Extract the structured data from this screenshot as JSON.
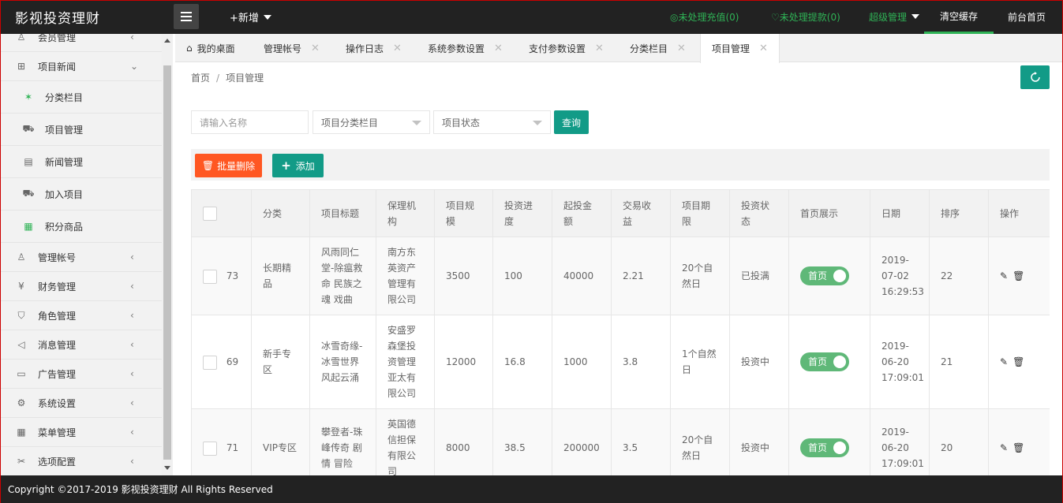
{
  "header": {
    "logo": "影视投资理财",
    "new_label": "+新增",
    "pending_recharge": "未处理充值(0)",
    "pending_withdraw": "未处理提款(0)",
    "admin_label": "超级管理",
    "clear_cache": "清空缓存",
    "front_home": "前台首页"
  },
  "sidebar": {
    "items": [
      {
        "label": "会员管理",
        "icon": "user-icon"
      },
      {
        "label": "项目新闻",
        "icon": "book-icon"
      },
      {
        "label": "分类栏目",
        "icon": "palm-icon"
      },
      {
        "label": "项目管理",
        "icon": "cart-icon"
      },
      {
        "label": "新闻管理",
        "icon": "doc-icon"
      },
      {
        "label": "加入项目",
        "icon": "cart-add-icon"
      },
      {
        "label": "积分商品",
        "icon": "grid-icon"
      },
      {
        "label": "管理帐号",
        "icon": "user-icon"
      },
      {
        "label": "财务管理",
        "icon": "yen-icon"
      },
      {
        "label": "角色管理",
        "icon": "shield-icon"
      },
      {
        "label": "消息管理",
        "icon": "speaker-icon"
      },
      {
        "label": "广告管理",
        "icon": "image-icon"
      },
      {
        "label": "系统设置",
        "icon": "gear-icon"
      },
      {
        "label": "菜单管理",
        "icon": "apps-icon"
      },
      {
        "label": "选项配置",
        "icon": "tools-icon"
      }
    ]
  },
  "tabs": [
    {
      "label": "我的桌面"
    },
    {
      "label": "管理帐号"
    },
    {
      "label": "操作日志"
    },
    {
      "label": "系统参数设置"
    },
    {
      "label": "支付参数设置"
    },
    {
      "label": "分类栏目"
    },
    {
      "label": "项目管理"
    }
  ],
  "breadcrumb": {
    "home": "首页",
    "sep": "/",
    "current": "项目管理"
  },
  "filters": {
    "name_placeholder": "请输入名称",
    "category_select": "项目分类栏目",
    "status_select": "项目状态",
    "query": "查询"
  },
  "toolbar": {
    "batch_delete": "批量删除",
    "add": "添加"
  },
  "table": {
    "headers": [
      "分类",
      "项目标题",
      "保理机构",
      "项目规模",
      "投资进度",
      "起投金额",
      "交易收益",
      "项目期限",
      "投资状态",
      "首页展示",
      "日期",
      "排序",
      "操作"
    ],
    "rows": [
      {
        "id": "73",
        "category": "长期精品",
        "title": "风雨同仁堂-除瘟救命 民族之魂 戏曲",
        "agency": "南方东英资产管理有限公司",
        "scale": "3500",
        "progress": "100",
        "min_invest": "40000",
        "yield": "2.21",
        "term": "20个自然日",
        "status": "已投满",
        "home_show": "首页",
        "date": "2019-07-02 16:29:53",
        "sort": "22"
      },
      {
        "id": "69",
        "category": "新手专区",
        "title": "冰雪奇缘-冰雪世界 风起云涌",
        "agency": "安盛罗森堡投资管理亚太有限公司",
        "scale": "12000",
        "progress": "16.8",
        "min_invest": "1000",
        "yield": "3.8",
        "term": "1个自然日",
        "status": "投资中",
        "home_show": "首页",
        "date": "2019-06-20 17:09:01",
        "sort": "21"
      },
      {
        "id": "71",
        "category": "VIP专区",
        "title": "攀登者-珠峰传奇 剧情 冒险",
        "agency": "英国德信担保有限公司",
        "scale": "8000",
        "progress": "38.5",
        "min_invest": "200000",
        "yield": "3.5",
        "term": "20个自然日",
        "status": "投资中",
        "home_show": "首页",
        "date": "2019-06-20 17:09:01",
        "sort": "20"
      }
    ]
  },
  "footer": "Copyright ©2017-2019 影视投资理财 All Rights Reserved",
  "colors": {
    "primary": "#129b87",
    "danger": "#ff5722",
    "switch_on": "#5fb878",
    "topbar": "#222222",
    "green_text": "#2fb356"
  }
}
